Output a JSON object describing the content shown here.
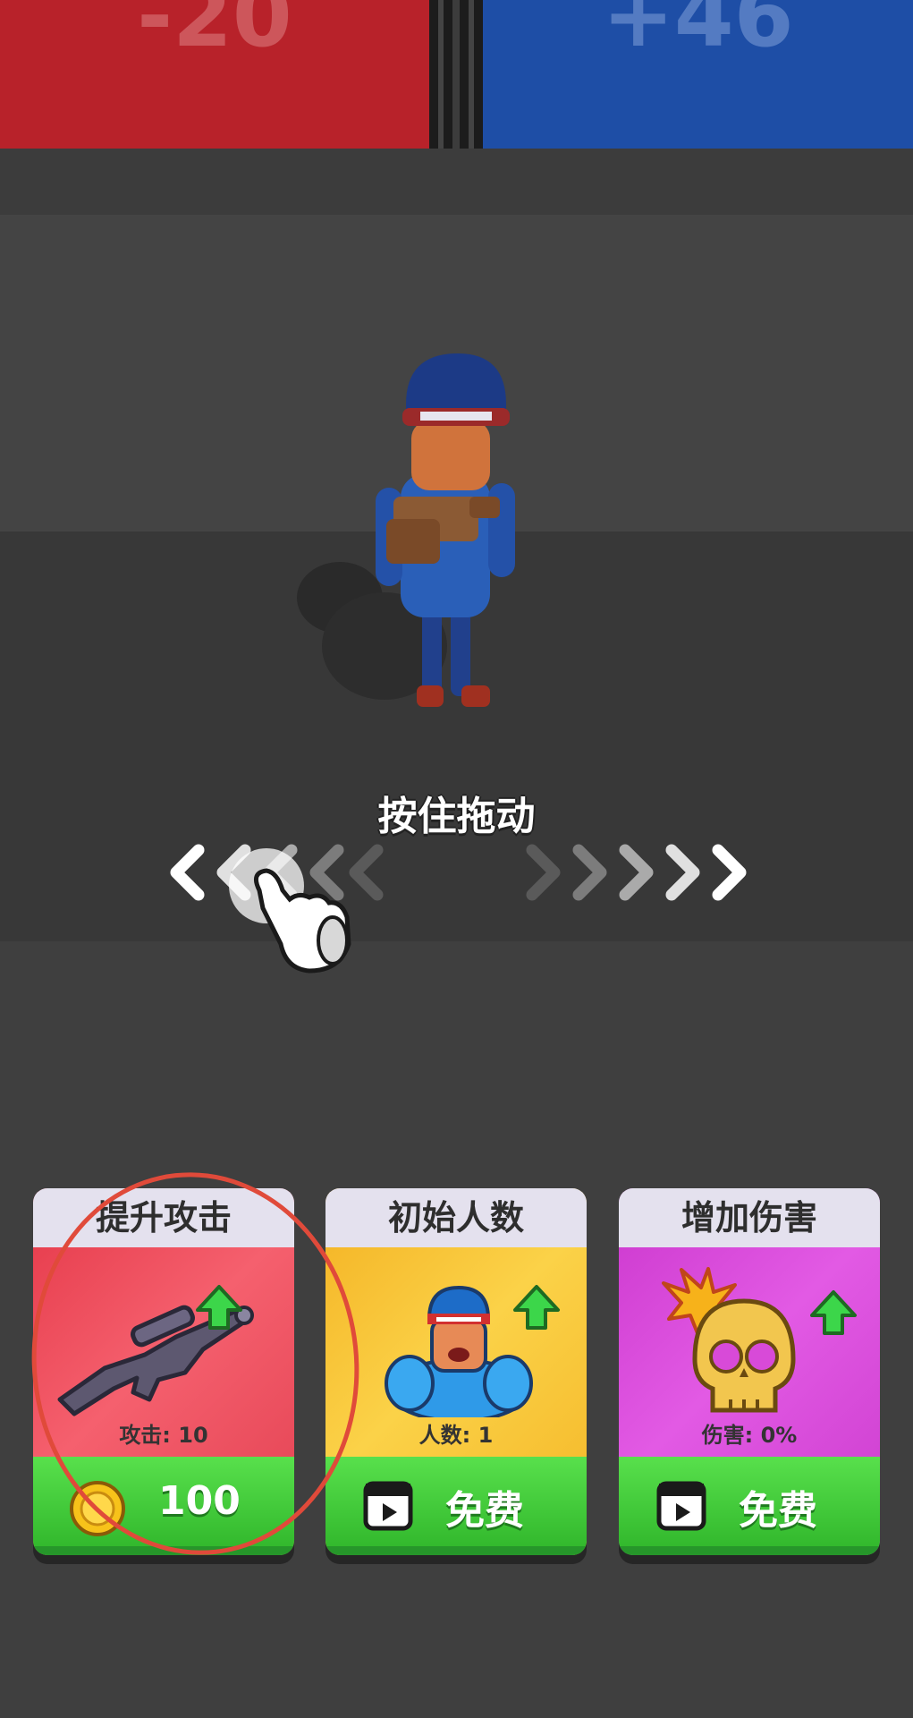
{
  "gates": {
    "left_value": "-20",
    "right_value": "+46",
    "left_color": "#b8222a",
    "right_color": "#1e4ea6"
  },
  "drag_hint": {
    "label": "按住拖动",
    "icons": [
      "chevron-left-icon",
      "chevron-right-icon",
      "hand-pointer-icon"
    ]
  },
  "upgrades": [
    {
      "title": "提升攻击",
      "stat": "攻击: 10",
      "button_label": "100",
      "button_icon": "coin-icon",
      "item_icon": "rifle-icon",
      "color": "#f05060"
    },
    {
      "title": "初始人数",
      "stat": "人数: 1",
      "button_label": "免费",
      "button_icon": "video-ad-icon",
      "item_icon": "muscle-man-icon",
      "color": "#f7c83a"
    },
    {
      "title": "增加伤害",
      "stat": "伤害: 0%",
      "button_label": "免费",
      "button_icon": "video-ad-icon",
      "item_icon": "skull-icon",
      "color": "#d84ad8"
    }
  ]
}
